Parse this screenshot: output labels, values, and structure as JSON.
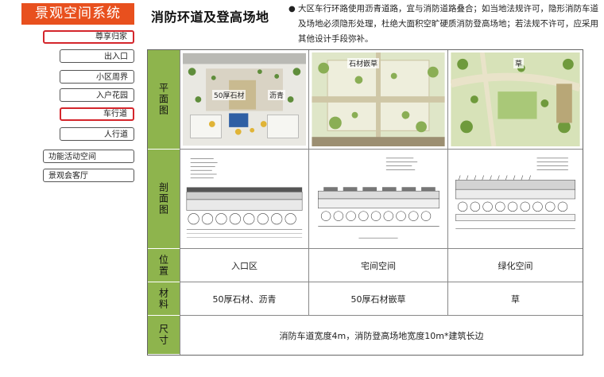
{
  "sidebar": {
    "title": "景观空间系统",
    "items": [
      {
        "label": "尊享归家",
        "active": true
      },
      {
        "label": "出入口",
        "active": false
      },
      {
        "label": "小区周界",
        "active": false
      },
      {
        "label": "入户花园",
        "active": false
      },
      {
        "label": "车行道",
        "active": true
      },
      {
        "label": "人行道",
        "active": false
      },
      {
        "label": "功能活动空间",
        "active": false
      },
      {
        "label": "景观会客厅",
        "active": false
      }
    ]
  },
  "header": {
    "title": "消防环道及登高场地",
    "description": "大区车行环路使用沥青道路，宜与消防道路叠合；如当地法规许可，隐形消防车道及场地必须隐形处理，杜绝大面积空旷硬质消防登高场地；若法规不许可，应采用其他设计手段弥补。"
  },
  "table": {
    "row_labels": {
      "plan": "平面图",
      "section": "剖面图",
      "position": "位置",
      "material": "材料",
      "size": "尺寸"
    },
    "plan_labels": [
      [
        "50厚石材",
        "沥青"
      ],
      [
        "石材嵌草"
      ],
      [
        "草"
      ]
    ],
    "positions": [
      "入口区",
      "宅间空间",
      "绿化空间"
    ],
    "materials": [
      "50厚石材、沥青",
      "50厚石材嵌草",
      "草"
    ],
    "size_text": "消防车道宽度4m，消防登高场地宽度10m*建筑长边"
  }
}
